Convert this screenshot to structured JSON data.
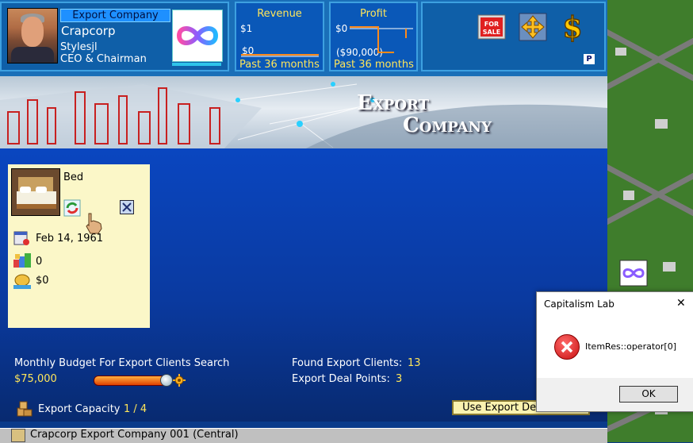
{
  "header": {
    "company_label": "Export Company",
    "company_name": "Crapcorp",
    "ceo_name": "Stylesjl",
    "ceo_title": "CEO & Chairman"
  },
  "revenue_panel": {
    "title": "Revenue",
    "top_label": "$1",
    "bottom_label": "$0",
    "period": "Past 36 months"
  },
  "profit_panel": {
    "title": "Profit",
    "top_label": "$0",
    "bottom_label": "($90,000)",
    "period": "Past 36 months"
  },
  "actions": {
    "for_sale_text": "FOR SALE",
    "p_badge": "P",
    "dollar_symbol": "$"
  },
  "banner": {
    "title_line1": "Export",
    "title_line2": "Company"
  },
  "product_card": {
    "product_name": "Bed",
    "date": "Feb 14, 1961",
    "quantity": "0",
    "amount": "$0"
  },
  "budget": {
    "label": "Monthly Budget For Export Clients Search",
    "value": "$75,000",
    "slider_level": 0.93
  },
  "clients": {
    "found_label": "Found Export Clients:",
    "found_value": "13",
    "deal_points_label": "Export Deal Points:",
    "deal_points_value": "3"
  },
  "capacity": {
    "label": "Export Capacity",
    "value": "1 / 4"
  },
  "use_deal_button": "Use Export Deal Points",
  "status_bar": {
    "text": "Crapcorp Export Company 001 (Central)"
  },
  "dialog": {
    "title": "Capitalism Lab",
    "message": "ItemRes::operator[0]",
    "ok_label": "OK",
    "close_symbol": "✕"
  },
  "colors": {
    "accent_yellow": "#ffe65a",
    "panel_blue": "#0f5fa8",
    "main_blue": "#0a46c0",
    "card_bg": "#fbf7c8",
    "graph_line": "#ff8a1a"
  },
  "icons": [
    "portrait-image",
    "infinity-logo-icon",
    "for-sale-sign-icon",
    "move-arrows-icon",
    "dollar-sign-icon",
    "bed-product-image",
    "refresh-product-icon",
    "close-x-icon",
    "calendar-icon",
    "blocks-icon",
    "coins-icon",
    "boxes-icon",
    "pointer-hand-icon",
    "gear-icon",
    "error-icon"
  ]
}
